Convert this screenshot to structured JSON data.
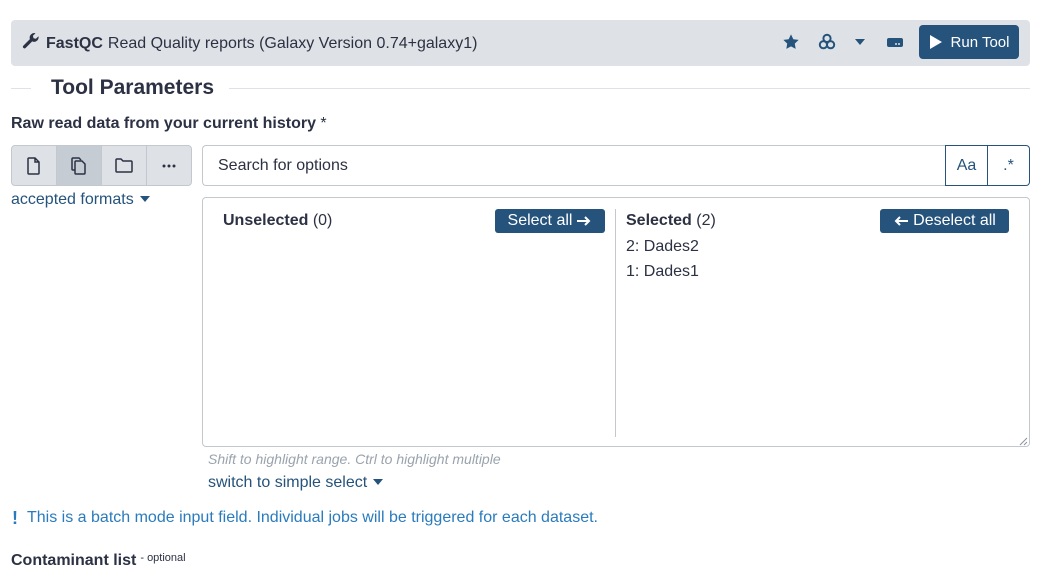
{
  "header": {
    "tool_name": "FastQC",
    "tool_title": "Read Quality reports (Galaxy Version 0.74+galaxy1)",
    "run_label": "Run Tool",
    "icons": [
      "wrench-icon",
      "star-icon",
      "objects-icon",
      "caret-down-icon",
      "hdd-icon",
      "play-icon"
    ]
  },
  "section": {
    "title": "Tool Parameters"
  },
  "param": {
    "label": "Raw read data from your current history",
    "required_mark": "*",
    "source_buttons": [
      {
        "icon": "file-icon",
        "active": false
      },
      {
        "icon": "copy-icon",
        "active": true
      },
      {
        "icon": "folder-icon",
        "active": false
      },
      {
        "icon": "ellipsis-icon",
        "active": false
      }
    ],
    "accepted_formats": "accepted formats",
    "search_placeholder": "Search for options",
    "case_toggle": "Aa",
    "regex_toggle": ".*"
  },
  "selection": {
    "unselected_title": "Unselected",
    "unselected_count": "(0)",
    "select_all": "Select all",
    "selected_title": "Selected",
    "selected_count": "(2)",
    "deselect_all": "Deselect all",
    "selected_items": [
      "2: Dades2",
      "1: Dades1"
    ],
    "hint": "Shift to highlight range. Ctrl to highlight multiple",
    "switch_label": "switch to simple select"
  },
  "batch_notice": {
    "mark": "!",
    "text": "This is a batch mode input field. Individual jobs will be triggered for each dataset."
  },
  "next_param": {
    "label": "Contaminant list",
    "optional": "- optional"
  },
  "colors": {
    "primary": "#25537b",
    "header_bg": "#dee2e6",
    "info": "#2a7bbd",
    "text": "#2c3143"
  }
}
